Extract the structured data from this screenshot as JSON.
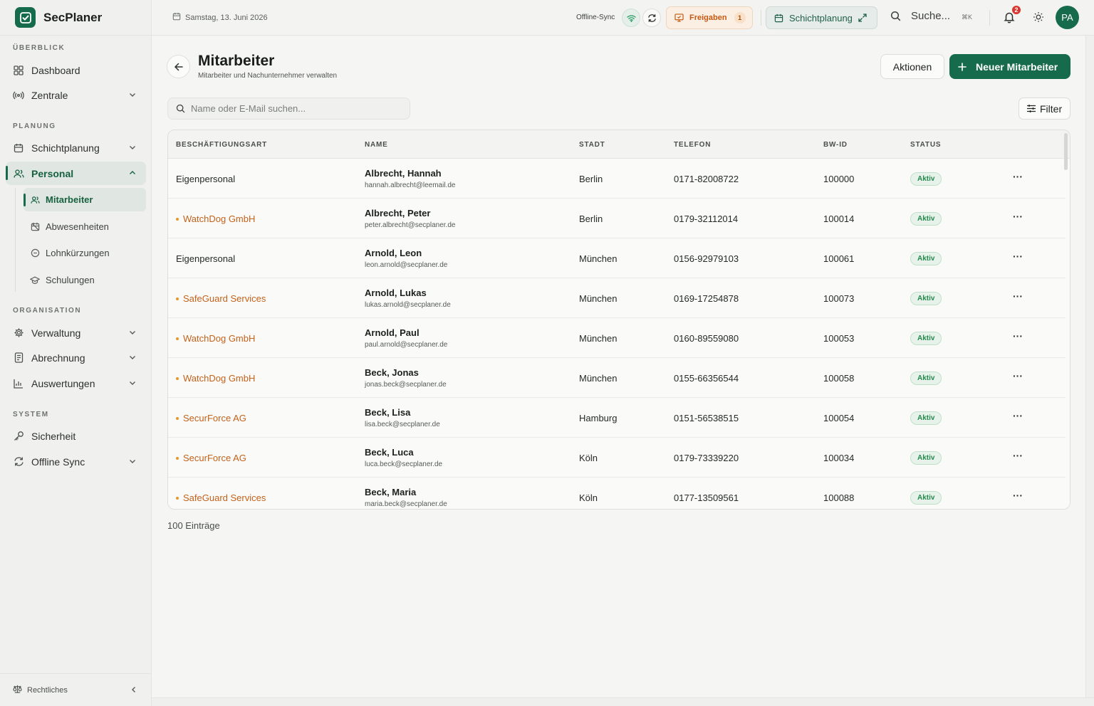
{
  "app": {
    "name": "SecPlaner"
  },
  "sidebar": {
    "sections": {
      "overview": "ÜBERBLICK",
      "planning": "PLANUNG",
      "organisation": "ORGANISATION",
      "system": "SYSTEM"
    },
    "items": {
      "dashboard": "Dashboard",
      "zentrale": "Zentrale",
      "schichtplanung": "Schichtplanung",
      "personal": "Personal",
      "verwaltung": "Verwaltung",
      "abrechnung": "Abrechnung",
      "auswertungen": "Auswertungen",
      "sicherheit": "Sicherheit",
      "offline_sync": "Offline Sync"
    },
    "sub_items": {
      "mitarbeiter": "Mitarbeiter",
      "abwesenheiten": "Abwesenheiten",
      "lohnkuerzungen": "Lohnkürzungen",
      "schulungen": "Schulungen"
    },
    "footer": "Rechtliches"
  },
  "topbar": {
    "date": "Samstag, 13. Juni 2026",
    "sync_label": "Offline-Sync",
    "freigaben_label": "Freigaben",
    "freigaben_count": "1",
    "schichtplanung_label": "Schichtplanung",
    "search_label": "Suche...",
    "search_shortcut": "⌘K",
    "notification_count": "2",
    "avatar_initials": "PA"
  },
  "page": {
    "title": "Mitarbeiter",
    "subtitle": "Mitarbeiter und Nachunternehmer verwalten",
    "aktionen_label": "Aktionen",
    "new_label": "Neuer Mitarbeiter",
    "search_placeholder": "Name oder E-Mail suchen...",
    "filter_label": "Filter",
    "entries_count": "100 Einträge"
  },
  "table": {
    "headers": [
      "BESCHÄFTIGUNGSART",
      "NAME",
      "STADT",
      "TELEFON",
      "BW-ID",
      "STATUS"
    ],
    "rows": [
      {
        "type": "Eigenpersonal",
        "subcontractor": false,
        "name": "Albrecht, Hannah",
        "email": "hannah.albrecht@leemail.de",
        "city": "Berlin",
        "phone": "0171-82008722",
        "bwid": "100000",
        "status": "Aktiv"
      },
      {
        "type": "WatchDog GmbH",
        "subcontractor": true,
        "name": "Albrecht, Peter",
        "email": "peter.albrecht@secplaner.de",
        "city": "Berlin",
        "phone": "0179-32112014",
        "bwid": "100014",
        "status": "Aktiv"
      },
      {
        "type": "Eigenpersonal",
        "subcontractor": false,
        "name": "Arnold, Leon",
        "email": "leon.arnold@secplaner.de",
        "city": "München",
        "phone": "0156-92979103",
        "bwid": "100061",
        "status": "Aktiv"
      },
      {
        "type": "SafeGuard Services",
        "subcontractor": true,
        "name": "Arnold, Lukas",
        "email": "lukas.arnold@secplaner.de",
        "city": "München",
        "phone": "0169-17254878",
        "bwid": "100073",
        "status": "Aktiv"
      },
      {
        "type": "WatchDog GmbH",
        "subcontractor": true,
        "name": "Arnold, Paul",
        "email": "paul.arnold@secplaner.de",
        "city": "München",
        "phone": "0160-89559080",
        "bwid": "100053",
        "status": "Aktiv"
      },
      {
        "type": "WatchDog GmbH",
        "subcontractor": true,
        "name": "Beck, Jonas",
        "email": "jonas.beck@secplaner.de",
        "city": "München",
        "phone": "0155-66356544",
        "bwid": "100058",
        "status": "Aktiv"
      },
      {
        "type": "SecurForce AG",
        "subcontractor": true,
        "name": "Beck, Lisa",
        "email": "lisa.beck@secplaner.de",
        "city": "Hamburg",
        "phone": "0151-56538515",
        "bwid": "100054",
        "status": "Aktiv"
      },
      {
        "type": "SecurForce AG",
        "subcontractor": true,
        "name": "Beck, Luca",
        "email": "luca.beck@secplaner.de",
        "city": "Köln",
        "phone": "0179-73339220",
        "bwid": "100034",
        "status": "Aktiv"
      },
      {
        "type": "SafeGuard Services",
        "subcontractor": true,
        "name": "Beck, Maria",
        "email": "maria.beck@secplaner.de",
        "city": "Köln",
        "phone": "0177-13509561",
        "bwid": "100088",
        "status": "Aktiv"
      }
    ]
  },
  "colors": {
    "brand": "#176b4d",
    "subcontractor": "#c4621a",
    "status_active": "#23884c",
    "notification": "#d9362f"
  }
}
